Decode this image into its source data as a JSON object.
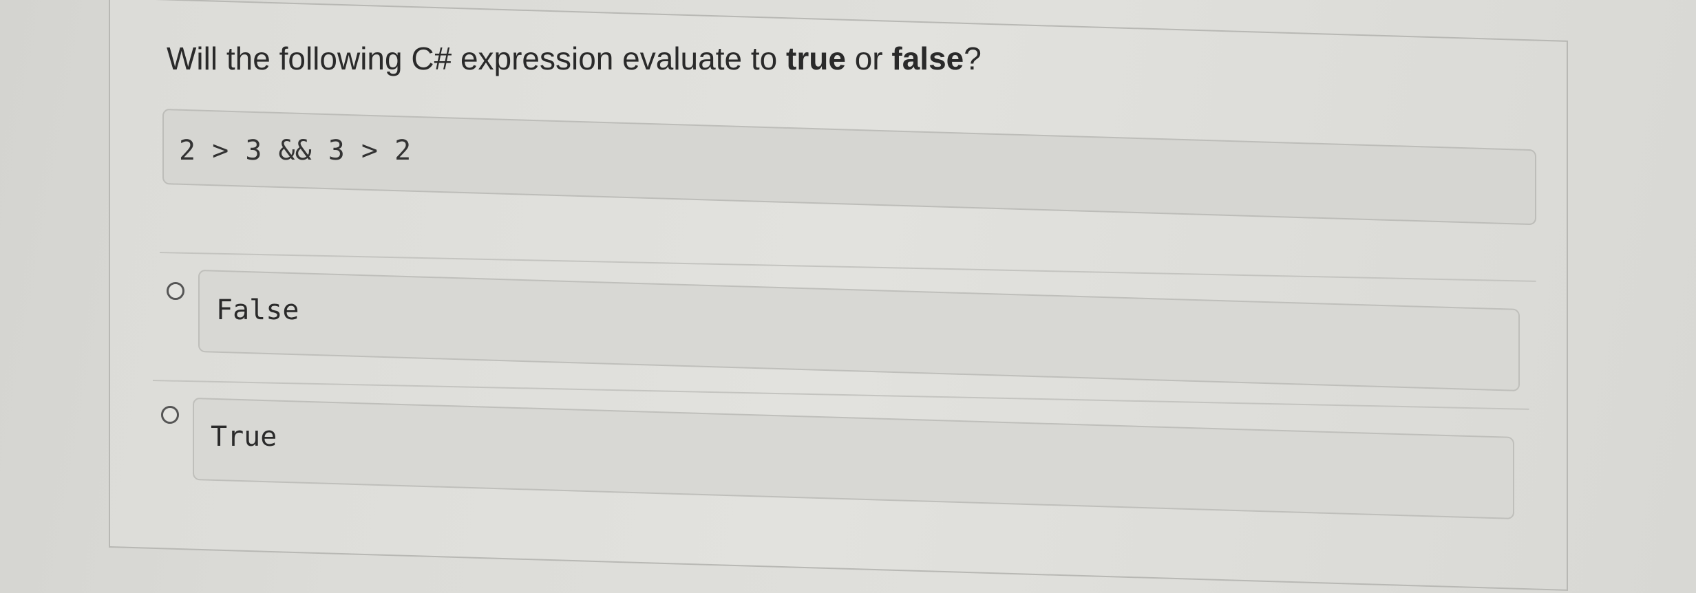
{
  "question": {
    "prefix": "Will the following C# expression evaluate to ",
    "bold_true": "true",
    "middle": " or ",
    "bold_false": "false",
    "suffix": "?"
  },
  "code": "2 > 3 && 3 > 2",
  "options": [
    {
      "label": "False",
      "selected": false
    },
    {
      "label": "True",
      "selected": false
    }
  ]
}
